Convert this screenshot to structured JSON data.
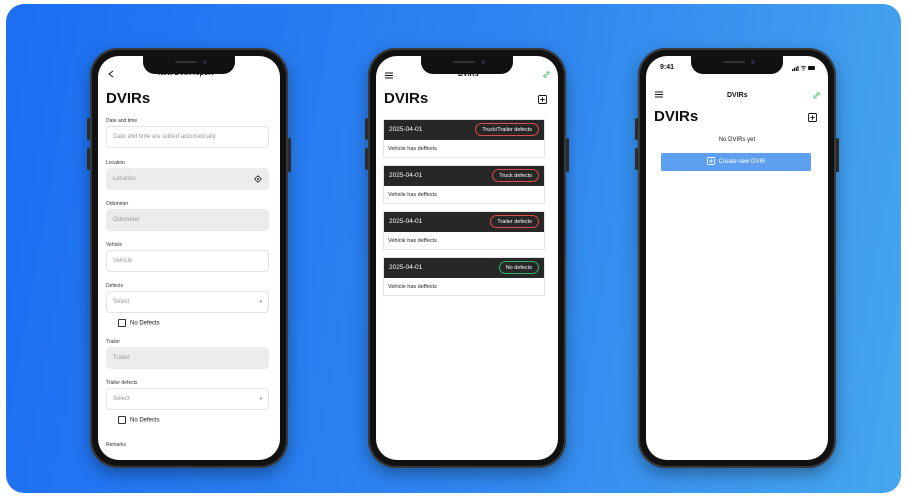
{
  "colors": {
    "background_start": "#1c6ef2",
    "background_end": "#46a6ee",
    "defect_badge": "#e34a4a",
    "ok_badge": "#2fb36a",
    "link_icon": "#3db35a",
    "cta": "#5ea0ef"
  },
  "phone1": {
    "header_title": "New DVIR report",
    "title": "DVIRs",
    "fields": {
      "datetime_label": "Date and time",
      "datetime_placeholder": "Date and time are added automatically",
      "location_label": "Location",
      "location_placeholder": "Location",
      "odometer_label": "Odometer",
      "odometer_placeholder": "Odometer",
      "vehicle_label": "Vehicle",
      "vehicle_placeholder": "Vehicle",
      "defects_label": "Defects",
      "defects_select": "Select",
      "no_defects_1": "No Defects",
      "trailer_label": "Trailer",
      "trailer_placeholder": "Trailer",
      "trailer_defects_label": "Trailer defects",
      "trailer_defects_select": "Select",
      "no_defects_2": "No Defects",
      "remarks_label": "Remarks"
    }
  },
  "phone2": {
    "header_title": "DVIRs",
    "title": "DVIRs",
    "reports": [
      {
        "date": "2025-04-01",
        "badge": "Truck/Trailer defects",
        "text": "Vehicle has deffects"
      },
      {
        "date": "2025-04-01",
        "badge": "Truck defects",
        "text": "Vehicle has deffects"
      },
      {
        "date": "2025-04-01",
        "badge": "Trailer defects",
        "text": "Vehicle has deffects"
      },
      {
        "date": "2025-04-01",
        "badge": "No defects",
        "text": "Vehicle has deffects"
      }
    ]
  },
  "phone3": {
    "time": "9:41",
    "header_title": "DVIRs",
    "title": "DVIRs",
    "empty_text": "No DVIRs yet",
    "create_button": "Create new DVIR"
  }
}
